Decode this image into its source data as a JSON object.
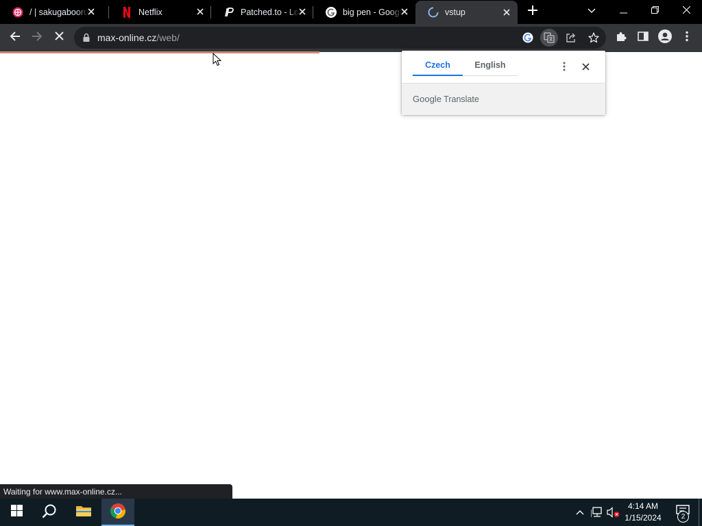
{
  "browser": {
    "tabs": [
      {
        "title": "/ | sakugabooru",
        "icon": "sakugabooru-icon",
        "active": false
      },
      {
        "title": "Netflix",
        "icon": "netflix-icon",
        "active": false
      },
      {
        "title": "Patched.to - Log",
        "icon": "patched-icon",
        "active": false
      },
      {
        "title": "big pen - Google",
        "icon": "google-icon",
        "active": false
      },
      {
        "title": "vstup",
        "icon": "loading-icon",
        "active": true
      }
    ],
    "url": {
      "host": "max-online.cz",
      "path": "/web/"
    },
    "loading_progress": 0.455
  },
  "translate_popup": {
    "source_language": "Czech",
    "target_language": "English",
    "brand_google": "Google",
    "brand_product": "Translate"
  },
  "status_bubble": "Waiting for www.max-online.cz...",
  "taskbar": {
    "time": "4:14 AM",
    "date": "1/15/2024",
    "notification_count": "2"
  },
  "colors": {
    "tab_strip": "#000000",
    "toolbar": "#35363a",
    "omnibox": "#202124",
    "accent_blue": "#1a73e8",
    "load_bar": "#c98a72",
    "taskbar": "#0f1c24"
  }
}
